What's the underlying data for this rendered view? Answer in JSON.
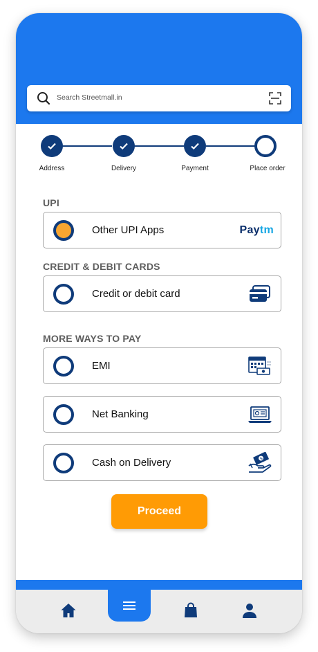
{
  "search": {
    "placeholder": "Search Streetmall.in"
  },
  "steps": [
    {
      "label": "Address",
      "done": true
    },
    {
      "label": "Delivery",
      "done": true
    },
    {
      "label": "Payment",
      "done": true
    },
    {
      "label": "Place order",
      "done": false
    }
  ],
  "sections": {
    "upi": "UPI",
    "cards": "CREDIT & DEBIT CARDS",
    "more": "MORE WAYS TO PAY"
  },
  "options": {
    "upi": {
      "label": "Other UPI Apps",
      "selected": true,
      "brand_pay": "Pay",
      "brand_tm": "tm"
    },
    "card": {
      "label": "Credit or debit card",
      "selected": false
    },
    "emi": {
      "label": "EMI",
      "selected": false
    },
    "netbanking": {
      "label": "Net Banking",
      "selected": false
    },
    "cod": {
      "label": "Cash on Delivery",
      "selected": false
    }
  },
  "proceed_label": "Proceed",
  "nav": [
    "home-icon",
    "menu-icon",
    "bag-icon",
    "user-icon"
  ],
  "colors": {
    "primary": "#1c78ee",
    "navy": "#0f3b7a",
    "accent": "#ff9b05",
    "selected_radio": "#f7a530"
  }
}
